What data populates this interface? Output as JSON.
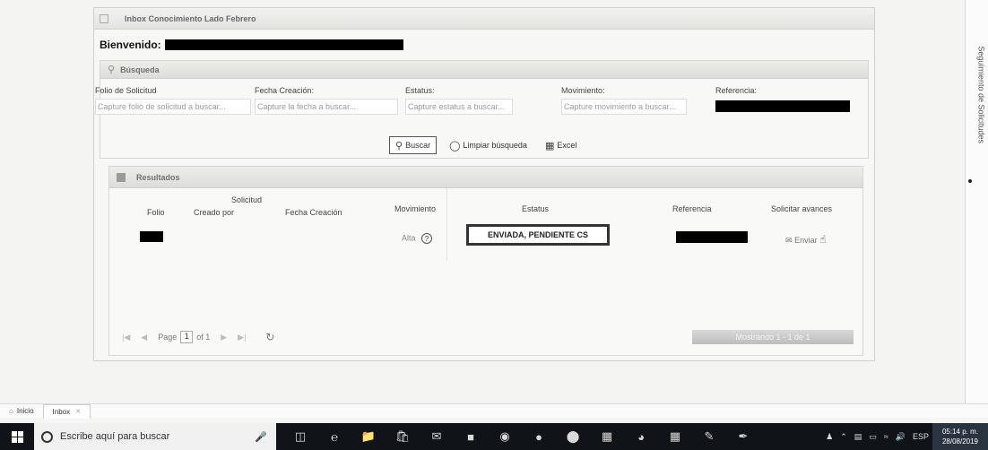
{
  "window": {
    "title": "Inbox Conocimiento Lado Febrero"
  },
  "welcome": {
    "label": "Bienvenido:"
  },
  "search": {
    "header": "Búsqueda",
    "fields": [
      {
        "label": "Folio de Solicitud",
        "placeholder": "Capture folio de solicitud a buscar..."
      },
      {
        "label": "Fecha Creación:",
        "placeholder": "Capture la fecha a buscar..."
      },
      {
        "label": "Estatus:",
        "placeholder": "Capture estatus a buscar..."
      },
      {
        "label": "Movimiento:",
        "placeholder": "Capture movimiento a buscar..."
      },
      {
        "label": "Referencia:",
        "placeholder": ""
      }
    ],
    "buttons": {
      "search": "Buscar",
      "clear": "Limpiar búsqueda",
      "excel": "Excel"
    }
  },
  "results": {
    "header": "Resultados",
    "columns": {
      "group": "Solicitud",
      "folio": "Folio",
      "created_by": "Creado por",
      "created_date": "Fecha Creación",
      "movement": "Movimiento",
      "status": "Estatus",
      "reference": "Referencia",
      "request_progress": "Solicitar avances"
    },
    "rows": [
      {
        "movement": "Alta",
        "status": "ENVIADA, PENDIENTE CS",
        "action": "Enviar"
      }
    ],
    "pager": {
      "page_label": "Page",
      "page": "1",
      "of_label": "of 1",
      "count": "Mostrando 1 - 1 de 1"
    }
  },
  "right_rail": {
    "label": "Seguimiento de Solicitudes"
  },
  "tabs": [
    {
      "label": "Inicio"
    },
    {
      "label": "Inbox"
    }
  ],
  "taskbar": {
    "search_placeholder": "Escribe aquí para buscar",
    "language": "ESP",
    "time": "05:14 p. m.",
    "date": "28/08/2019"
  }
}
